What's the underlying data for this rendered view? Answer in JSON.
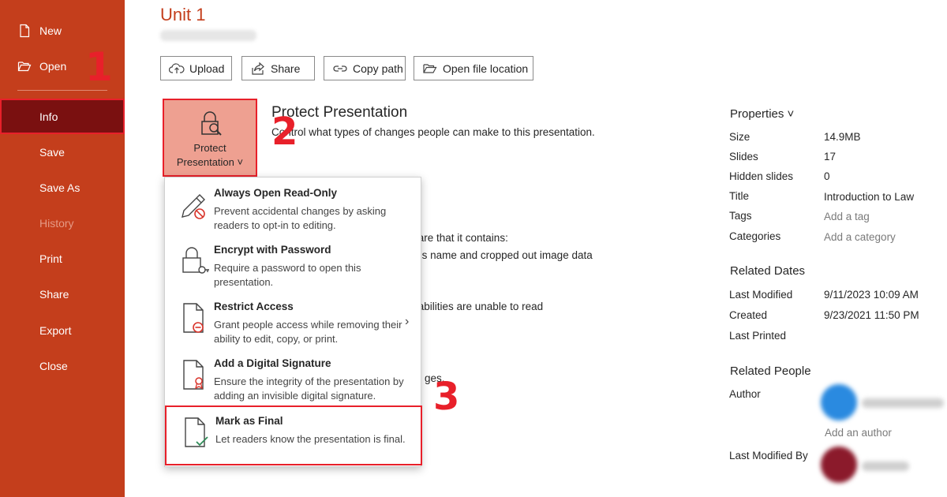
{
  "sidebar": {
    "items": [
      {
        "label": "New"
      },
      {
        "label": "Open"
      },
      {
        "label": "Info"
      },
      {
        "label": "Save"
      },
      {
        "label": "Save As"
      },
      {
        "label": "History"
      },
      {
        "label": "Print"
      },
      {
        "label": "Share"
      },
      {
        "label": "Export"
      },
      {
        "label": "Close"
      }
    ]
  },
  "annotations": {
    "step1": "1",
    "step2": "2",
    "step3": "3"
  },
  "header": {
    "title": "Unit 1"
  },
  "toolbar": {
    "upload_label": "Upload",
    "share_label": "Share",
    "copy_path_label": "Copy path",
    "open_location_label": "Open file location"
  },
  "protect": {
    "tile_line1": "Protect",
    "tile_line2": "Presentation ˅",
    "title": "Protect Presentation",
    "description": "Control what types of changes people can make to this presentation."
  },
  "background_text": {
    "line1": "ware that it contains:",
    "line2": "or's name and cropped out image data",
    "line3": "isabilities are unable to read",
    "line4": "ges."
  },
  "menu": {
    "items": [
      {
        "title": "Always Open Read-Only",
        "desc": "Prevent accidental changes by asking readers to opt-in to editing."
      },
      {
        "title": "Encrypt with Password",
        "desc": "Require a password to open this presentation."
      },
      {
        "title": "Restrict Access",
        "desc": "Grant people access while removing their ability to edit, copy, or print."
      },
      {
        "title": "Add a Digital Signature",
        "desc": "Ensure the integrity of the presentation by adding an invisible digital signature."
      },
      {
        "title": "Mark as Final",
        "desc": "Let readers know the presentation is final."
      }
    ]
  },
  "properties": {
    "heading": "Properties ˅",
    "rows": [
      {
        "label": "Size",
        "value": "14.9MB"
      },
      {
        "label": "Slides",
        "value": "17"
      },
      {
        "label": "Hidden slides",
        "value": "0"
      },
      {
        "label": "Title",
        "value": "Introduction  to Law"
      },
      {
        "label": "Tags",
        "value": "Add a tag"
      },
      {
        "label": "Categories",
        "value": "Add a category"
      }
    ]
  },
  "related_dates": {
    "heading": "Related Dates",
    "rows": [
      {
        "label": "Last Modified",
        "value": "9/11/2023 10:09 AM"
      },
      {
        "label": "Created",
        "value": "9/23/2021 11:50 PM"
      },
      {
        "label": "Last Printed",
        "value": ""
      }
    ]
  },
  "related_people": {
    "heading": "Related People",
    "author_label": "Author",
    "add_author": "Add an author",
    "last_modified_by_label": "Last Modified By"
  },
  "colors": {
    "accent": "#c43e1c",
    "highlight": "#e8202a",
    "active_nav": "#7a1010"
  }
}
